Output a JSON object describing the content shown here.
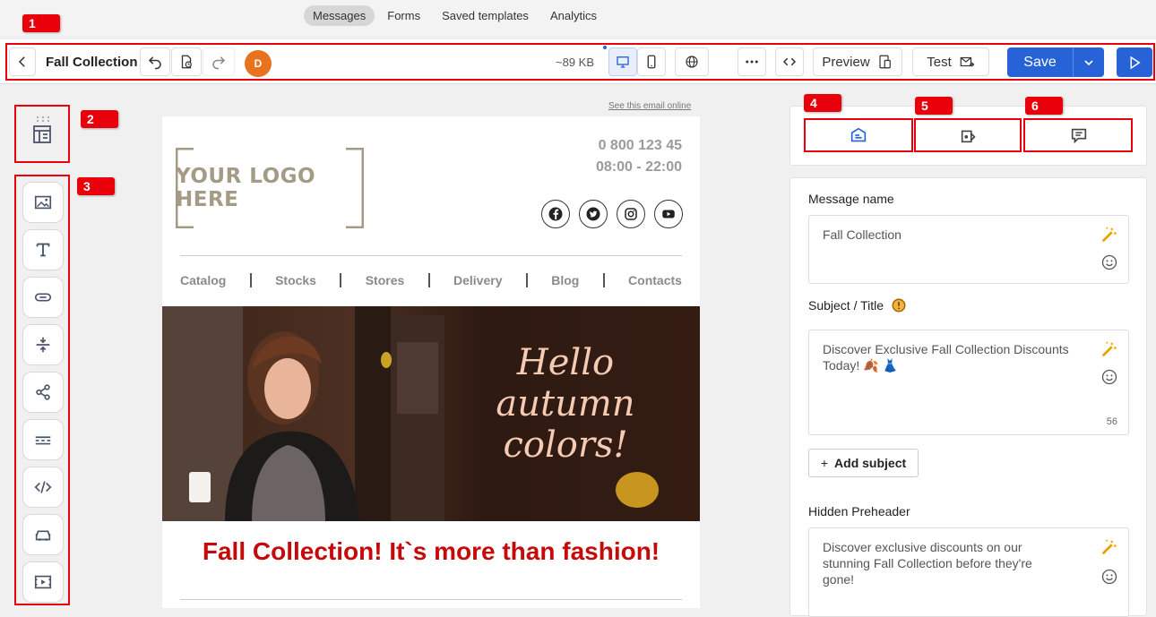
{
  "top_nav": {
    "tabs": [
      {
        "label": "Messages",
        "active": true
      },
      {
        "label": "Forms"
      },
      {
        "label": "Saved templates"
      },
      {
        "label": "Analytics"
      }
    ]
  },
  "callouts": [
    "1",
    "2",
    "3",
    "4",
    "5",
    "6"
  ],
  "toolbar": {
    "title": "Fall Collection",
    "avatar_initial": "D",
    "size": "~89 KB",
    "preview_label": "Preview",
    "test_label": "Test",
    "save_label": "Save"
  },
  "email": {
    "see_online": "See this email online",
    "logo_text": "YOUR LOGO HERE",
    "phone": "0 800 123 45",
    "hours": "08:00 - 22:00",
    "social": [
      "facebook-icon",
      "twitter-icon",
      "instagram-icon",
      "youtube-icon"
    ],
    "menu": [
      "Catalog",
      "Stocks",
      "Stores",
      "Delivery",
      "Blog",
      "Contacts"
    ],
    "hero_text": [
      "Hello",
      "autumn",
      "colors!"
    ],
    "headline": "Fall Collection! It`s more than fashion!"
  },
  "settings": {
    "message_name_label": "Message name",
    "message_name_value": "Fall Collection",
    "subject_label": "Subject / Title",
    "subject_value": "Discover Exclusive Fall Collection Discounts Today! 🍂 👗",
    "subject_count": "56",
    "add_subject_label": "Add subject",
    "preheader_label": "Hidden Preheader",
    "preheader_value": "Discover exclusive discounts on our stunning Fall Collection before they're gone!"
  },
  "colors": {
    "accent": "#2763d6",
    "callout": "#e8000b",
    "headline": "#c40a0a",
    "avatar": "#e8731c"
  }
}
